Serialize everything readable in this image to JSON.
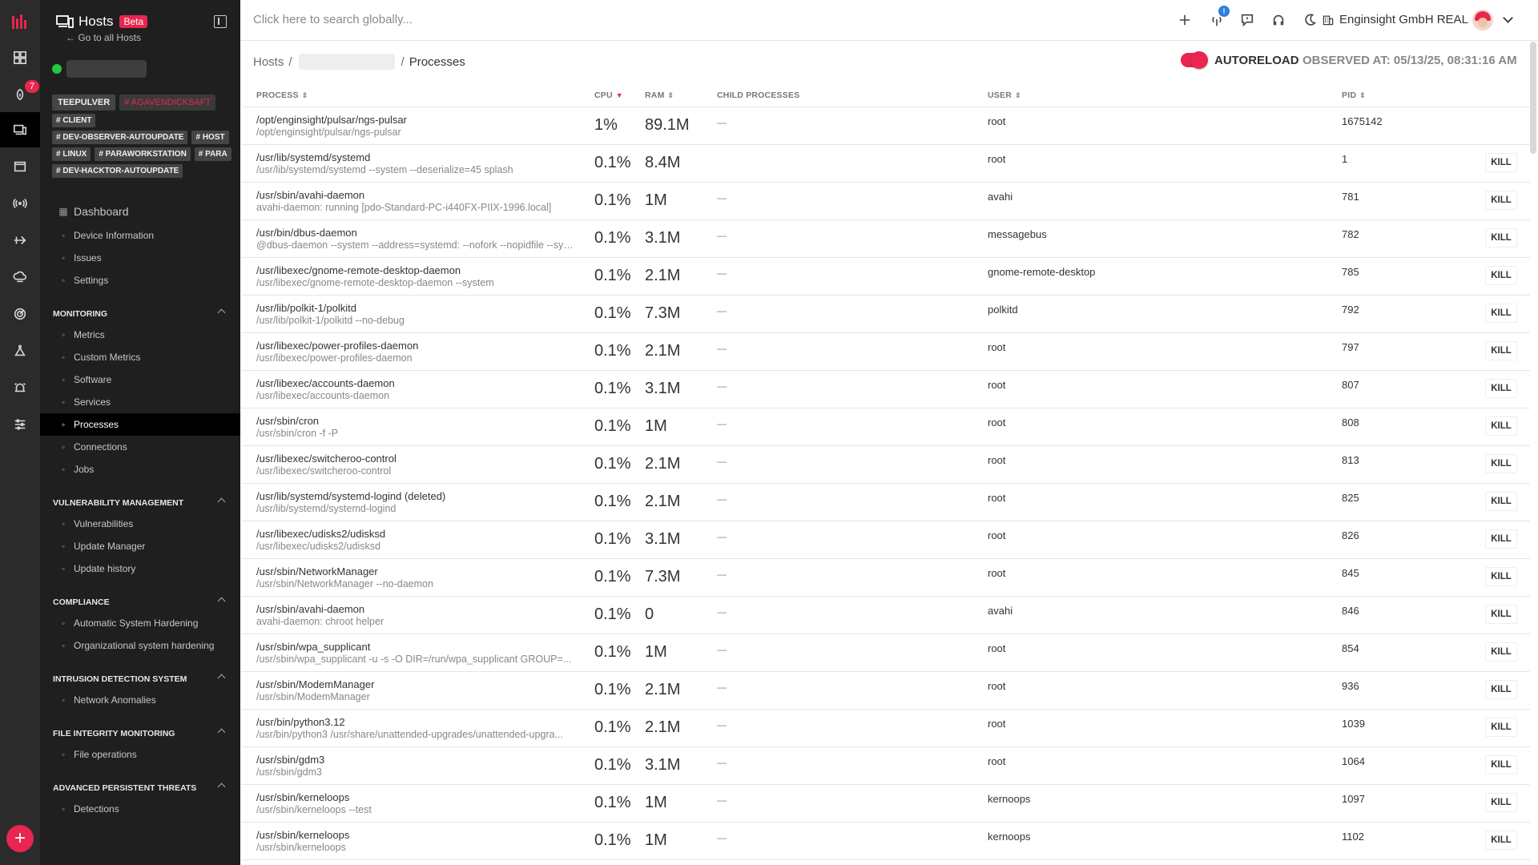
{
  "colors": {
    "accent": "#e8264f",
    "status_online": "#27c83f",
    "rail": "#2b2b2b",
    "sidebar": "#1f1f1f"
  },
  "rail": {
    "icons": [
      "logo-icon",
      "dashboard-icon",
      "alerts-icon",
      "hosts-icon",
      "browser-icon",
      "network-icon",
      "route-icon",
      "cloud-icon",
      "radar-icon",
      "lab-icon",
      "alarm-icon",
      "sliders-icon"
    ],
    "alerts_badge": "7",
    "add_label": "+"
  },
  "sidebar": {
    "title": "Hosts",
    "beta_label": "Beta",
    "go_all_label": "← Go to all Hosts",
    "tags": [
      {
        "label": "TEEPULVER",
        "style": "big"
      },
      {
        "label": "# AGAVENDICKSAFT",
        "style": "pink"
      },
      {
        "label": "# CLIENT",
        "style": ""
      },
      {
        "label": "# DEV-OBSERVER-AUTOUPDATE",
        "style": ""
      },
      {
        "label": "# HOST",
        "style": ""
      },
      {
        "label": "# LINUX",
        "style": ""
      },
      {
        "label": "# PARAWORKSTATION",
        "style": ""
      },
      {
        "label": "# PARA",
        "style": ""
      },
      {
        "label": "# DEV-HACKTOR-AUTOUPDATE",
        "style": ""
      }
    ],
    "dashboard": "Dashboard",
    "top_items": [
      "Device Information",
      "Issues",
      "Settings"
    ],
    "monitoring": {
      "title": "MONITORING",
      "items": [
        "Metrics",
        "Custom Metrics",
        "Software",
        "Services",
        "Processes",
        "Connections",
        "Jobs"
      ]
    },
    "vulnerability": {
      "title": "VULNERABILITY MANAGEMENT",
      "items": [
        "Vulnerabilities",
        "Update Manager",
        "Update history"
      ]
    },
    "compliance": {
      "title": "COMPLIANCE",
      "items": [
        "Automatic System Hardening",
        "Organizational system hardening"
      ]
    },
    "ids": {
      "title": "INTRUSION DETECTION SYSTEM",
      "items": [
        "Network Anomalies"
      ]
    },
    "fim": {
      "title": "FILE INTEGRITY MONITORING",
      "items": [
        "File operations"
      ]
    },
    "apt": {
      "title": "ADVANCED PERSISTENT THREATS",
      "items": [
        "Detections"
      ]
    }
  },
  "topbar": {
    "search_placeholder": "Click here to search globally...",
    "notification_badge": "!",
    "company": "Enginsight GmbH REAL"
  },
  "header": {
    "breadcrumb_root": "Hosts",
    "breadcrumb_current": "Processes",
    "autoreload_label": "AUTORELOAD",
    "autoreload_on": true,
    "observed_at": "OBSERVED AT: 05/13/25, 08:31:16 AM"
  },
  "table": {
    "columns": [
      "PROCESS",
      "CPU",
      "RAM",
      "CHILD PROCESSES",
      "USER",
      "PID"
    ],
    "kill_label": "KILL",
    "rows": [
      {
        "name": "/opt/enginsight/pulsar/ngs-pulsar",
        "args": "/opt/enginsight/pulsar/ngs-pulsar",
        "cpu": "1%",
        "ram": "89.1M",
        "child": "—",
        "user": "root",
        "pid": "1675142",
        "kill": false
      },
      {
        "name": "/usr/lib/systemd/systemd",
        "args": "/usr/lib/systemd/systemd --system --deserialize=45 splash",
        "cpu": "0.1%",
        "ram": "8.4M",
        "child": "",
        "user": "root",
        "pid": "1",
        "kill": true
      },
      {
        "name": "/usr/sbin/avahi-daemon",
        "args": "avahi-daemon: running [pdo-Standard-PC-i440FX-PIIX-1996.local]",
        "cpu": "0.1%",
        "ram": "1M",
        "child": "—",
        "user": "avahi",
        "pid": "781",
        "kill": true
      },
      {
        "name": "/usr/bin/dbus-daemon",
        "args": "@dbus-daemon --system --address=systemd: --nofork --nopidfile --syst...",
        "cpu": "0.1%",
        "ram": "3.1M",
        "child": "—",
        "user": "messagebus",
        "pid": "782",
        "kill": true
      },
      {
        "name": "/usr/libexec/gnome-remote-desktop-daemon",
        "args": "/usr/libexec/gnome-remote-desktop-daemon --system",
        "cpu": "0.1%",
        "ram": "2.1M",
        "child": "—",
        "user": "gnome-remote-desktop",
        "pid": "785",
        "kill": true
      },
      {
        "name": "/usr/lib/polkit-1/polkitd",
        "args": "/usr/lib/polkit-1/polkitd --no-debug",
        "cpu": "0.1%",
        "ram": "7.3M",
        "child": "—",
        "user": "polkitd",
        "pid": "792",
        "kill": true
      },
      {
        "name": "/usr/libexec/power-profiles-daemon",
        "args": "/usr/libexec/power-profiles-daemon",
        "cpu": "0.1%",
        "ram": "2.1M",
        "child": "—",
        "user": "root",
        "pid": "797",
        "kill": true
      },
      {
        "name": "/usr/libexec/accounts-daemon",
        "args": "/usr/libexec/accounts-daemon",
        "cpu": "0.1%",
        "ram": "3.1M",
        "child": "—",
        "user": "root",
        "pid": "807",
        "kill": true
      },
      {
        "name": "/usr/sbin/cron",
        "args": "/usr/sbin/cron -f -P",
        "cpu": "0.1%",
        "ram": "1M",
        "child": "—",
        "user": "root",
        "pid": "808",
        "kill": true
      },
      {
        "name": "/usr/libexec/switcheroo-control",
        "args": "/usr/libexec/switcheroo-control",
        "cpu": "0.1%",
        "ram": "2.1M",
        "child": "—",
        "user": "root",
        "pid": "813",
        "kill": true
      },
      {
        "name": "/usr/lib/systemd/systemd-logind (deleted)",
        "args": "/usr/lib/systemd/systemd-logind",
        "cpu": "0.1%",
        "ram": "2.1M",
        "child": "—",
        "user": "root",
        "pid": "825",
        "kill": true
      },
      {
        "name": "/usr/libexec/udisks2/udisksd",
        "args": "/usr/libexec/udisks2/udisksd",
        "cpu": "0.1%",
        "ram": "3.1M",
        "child": "—",
        "user": "root",
        "pid": "826",
        "kill": true
      },
      {
        "name": "/usr/sbin/NetworkManager",
        "args": "/usr/sbin/NetworkManager --no-daemon",
        "cpu": "0.1%",
        "ram": "7.3M",
        "child": "—",
        "user": "root",
        "pid": "845",
        "kill": true
      },
      {
        "name": "/usr/sbin/avahi-daemon",
        "args": "avahi-daemon: chroot helper",
        "cpu": "0.1%",
        "ram": "0",
        "child": "—",
        "user": "avahi",
        "pid": "846",
        "kill": true
      },
      {
        "name": "/usr/sbin/wpa_supplicant",
        "args": "/usr/sbin/wpa_supplicant -u -s -O DIR=/run/wpa_supplicant GROUP=...",
        "cpu": "0.1%",
        "ram": "1M",
        "child": "—",
        "user": "root",
        "pid": "854",
        "kill": true
      },
      {
        "name": "/usr/sbin/ModemManager",
        "args": "/usr/sbin/ModemManager",
        "cpu": "0.1%",
        "ram": "2.1M",
        "child": "—",
        "user": "root",
        "pid": "936",
        "kill": true
      },
      {
        "name": "/usr/bin/python3.12",
        "args": "/usr/bin/python3 /usr/share/unattended-upgrades/unattended-upgra...",
        "cpu": "0.1%",
        "ram": "2.1M",
        "child": "—",
        "user": "root",
        "pid": "1039",
        "kill": true
      },
      {
        "name": "/usr/sbin/gdm3",
        "args": "/usr/sbin/gdm3",
        "cpu": "0.1%",
        "ram": "3.1M",
        "child": "—",
        "user": "root",
        "pid": "1064",
        "kill": true
      },
      {
        "name": "/usr/sbin/kerneloops",
        "args": "/usr/sbin/kerneloops --test",
        "cpu": "0.1%",
        "ram": "1M",
        "child": "—",
        "user": "kernoops",
        "pid": "1097",
        "kill": true
      },
      {
        "name": "/usr/sbin/kerneloops",
        "args": "/usr/sbin/kerneloops",
        "cpu": "0.1%",
        "ram": "1M",
        "child": "—",
        "user": "kernoops",
        "pid": "1102",
        "kill": true
      }
    ]
  }
}
